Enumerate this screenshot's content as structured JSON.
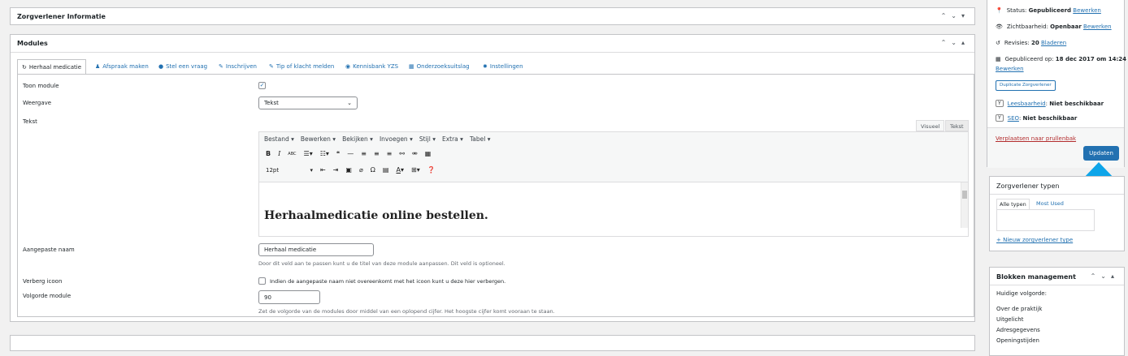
{
  "boxes": {
    "info_title": "Zorgverlener Informatie",
    "modules_title": "Modules"
  },
  "tabs": [
    {
      "label": "Herhaal medicatie",
      "icon": "refresh-icon"
    },
    {
      "label": "Afspraak maken",
      "icon": "users-icon"
    },
    {
      "label": "Stel een vraag",
      "icon": "chat-icon"
    },
    {
      "label": "Inschrijven",
      "icon": "edit-icon"
    },
    {
      "label": "Tip of klacht melden",
      "icon": "edit-icon"
    },
    {
      "label": "Kennisbank YZS",
      "icon": "globe-icon"
    },
    {
      "label": "Onderzoeksuitslag",
      "icon": "calendar-icon"
    },
    {
      "label": "Instellingen",
      "icon": "gear-icon"
    }
  ],
  "form": {
    "toon_module_label": "Toon module",
    "weergave_label": "Weergave",
    "weergave_value": "Tekst",
    "tekst_label": "Tekst",
    "aangepaste_naam_label": "Aangepaste naam",
    "aangepaste_naam_value": "Herhaal medicatie",
    "aangepaste_naam_desc": "Door dit veld aan te passen kunt u de titel van deze module aanpassen. Dit veld is optioneel.",
    "verberg_icoon_label": "Verberg icoon",
    "verberg_icoon_desc": "Indien de aangepaste naam niet overeenkomt met het icoon kunt u deze hier verbergen.",
    "volgorde_label": "Volgorde module",
    "volgorde_value": "90",
    "volgorde_desc": "Zet de volgorde van de modules door middel van een oplopend cijfer. Het hoogste cijfer komt vooraan te staan."
  },
  "editor": {
    "tab_visual": "Visueel",
    "tab_text": "Tekst",
    "menu": [
      "Bestand",
      "Bewerken",
      "Bekijken",
      "Invoegen",
      "Stijl",
      "Extra",
      "Tabel"
    ],
    "font_size": "12pt",
    "content_heading": "Herhaalmedicatie online bestellen."
  },
  "publish": {
    "status_label": "Status:",
    "status_value": "Gepubliceerd",
    "status_link": "Bewerken",
    "visibility_label": "Zichtbaarheid:",
    "visibility_value": "Openbaar",
    "visibility_link": "Bewerken",
    "revisions_label": "Revisies:",
    "revisions_value": "20",
    "revisions_link": "Bladeren",
    "published_label": "Gepubliceerd op:",
    "published_value": "18 dec 2017 om 14:24",
    "published_link": "Bewerken",
    "duplicate_button": "Duplicate Zorgverlener",
    "readability_link": "Leesbaarheid",
    "readability_value": "Niet beschikbaar",
    "seo_link": "SEO",
    "seo_value": "Niet beschikbaar",
    "trash_link": "Verplaatsen naar prullenbak",
    "update_button": "Updaten"
  },
  "types": {
    "title": "Zorgverlener typen",
    "tab_all": "Alle typen",
    "tab_used": "Most Used",
    "add_link": "+ Nieuw zorgverlener type"
  },
  "blocks": {
    "title": "Blokken management",
    "order_label": "Huidige volgorde:",
    "items": [
      "Over de praktijk",
      "Uitgelicht",
      "Adresgegevens",
      "Openingstijden"
    ]
  },
  "colors": {
    "accent": "#2271b1",
    "arrow": "#0ea5e9",
    "trash": "#b32d2e"
  }
}
